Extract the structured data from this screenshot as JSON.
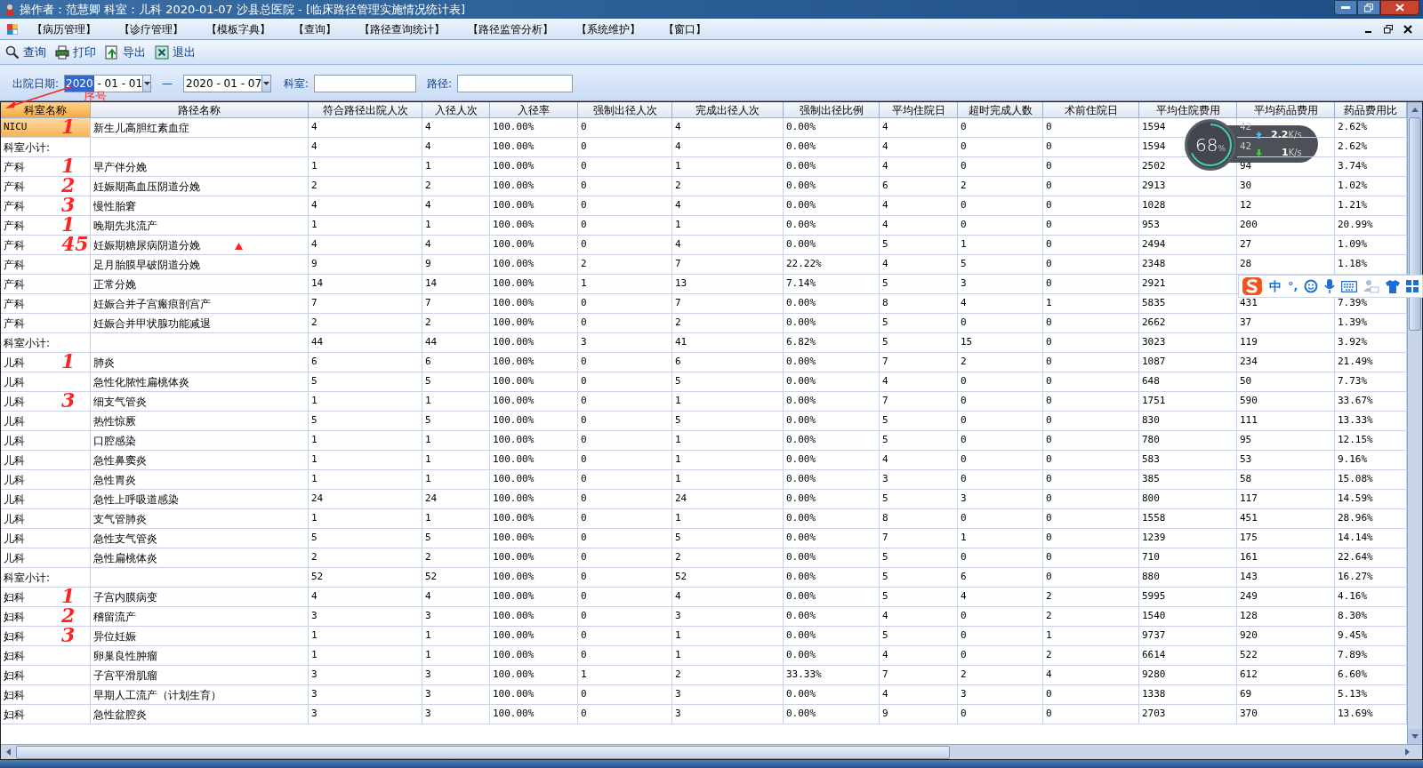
{
  "window": {
    "title": "操作者：范慧卿  科室：儿科  2020-01-07  沙县总医院 - [临床路径管理实施情况统计表]"
  },
  "menu": [
    "【病历管理】",
    "【诊疗管理】",
    "【模板字典】",
    "【查询】",
    "【路径查询统计】",
    "【路径监管分析】",
    "【系统维护】",
    "【窗口】"
  ],
  "toolbar": [
    {
      "kind": "search",
      "label": "查询"
    },
    {
      "kind": "print",
      "label": "打印"
    },
    {
      "kind": "export",
      "label": "导出"
    },
    {
      "kind": "exit",
      "label": "退出"
    }
  ],
  "filter": {
    "date_label": "出院日期:",
    "date_from": {
      "year": "2020",
      "rest": " - 01 - 01"
    },
    "separator": "—",
    "date_to": "2020 - 01 - 07",
    "dept_label": "科室:",
    "path_label": "路径:"
  },
  "annotation": {
    "text": "序号"
  },
  "table": {
    "columns": [
      {
        "label": "科室名称",
        "selected": true
      },
      {
        "label": "路径名称",
        "selected": false
      },
      {
        "label": "符合路径出院人次",
        "selected": false
      },
      {
        "label": "入径人次",
        "selected": false
      },
      {
        "label": "入径率",
        "selected": false
      },
      {
        "label": "强制出径人次",
        "selected": false
      },
      {
        "label": "完成出径人次",
        "selected": false
      },
      {
        "label": "强制出径比例",
        "selected": false
      },
      {
        "label": "平均住院日",
        "selected": false
      },
      {
        "label": "超时完成人数",
        "selected": false
      },
      {
        "label": "术前住院日",
        "selected": false
      },
      {
        "label": "平均住院费用",
        "selected": false
      },
      {
        "label": "平均药品费用",
        "selected": false
      },
      {
        "label": "药品费用比",
        "selected": false
      }
    ],
    "rows": [
      {
        "cells": [
          "NICU",
          "新生儿高胆红素血症",
          "4",
          "4",
          "100.00%",
          "0",
          "4",
          "0.00%",
          "4",
          "0",
          "0",
          "1594",
          "42",
          "2.62%"
        ],
        "selected": true,
        "flagged": false,
        "mark": "1"
      },
      {
        "cells": [
          "科室小计:",
          null,
          "4",
          "4",
          "100.00%",
          "0",
          "4",
          "0.00%",
          "4",
          "0",
          "0",
          "1594",
          "42",
          "2.62%"
        ],
        "selected": false,
        "flagged": false
      },
      {
        "cells": [
          "产科",
          "早产伴分娩",
          "1",
          "1",
          "100.00%",
          "0",
          "1",
          "0.00%",
          "4",
          "0",
          "0",
          "2502",
          "94",
          "3.74%"
        ],
        "selected": false,
        "flagged": false,
        "mark": "1"
      },
      {
        "cells": [
          "产科",
          "妊娠期高血压阴道分娩",
          "2",
          "2",
          "100.00%",
          "0",
          "2",
          "0.00%",
          "6",
          "2",
          "0",
          "2913",
          "30",
          "1.02%"
        ],
        "selected": false,
        "flagged": false,
        "mark": "2"
      },
      {
        "cells": [
          "产科",
          "慢性胎窘",
          "4",
          "4",
          "100.00%",
          "0",
          "4",
          "0.00%",
          "4",
          "0",
          "0",
          "1028",
          "12",
          "1.21%"
        ],
        "selected": false,
        "flagged": false,
        "mark": "3"
      },
      {
        "cells": [
          "产科",
          "晚期先兆流产",
          "1",
          "1",
          "100.00%",
          "0",
          "1",
          "0.00%",
          "4",
          "0",
          "0",
          "953",
          "200",
          "20.99%"
        ],
        "selected": false,
        "flagged": false,
        "mark": "1"
      },
      {
        "cells": [
          "产科",
          "妊娠期糖尿病阴道分娩",
          "4",
          "4",
          "100.00%",
          "0",
          "4",
          "0.00%",
          "5",
          "1",
          "0",
          "2494",
          "27",
          "1.09%"
        ],
        "selected": false,
        "flagged": true,
        "mark": "45"
      },
      {
        "cells": [
          "产科",
          "足月胎膜早破阴道分娩",
          "9",
          "9",
          "100.00%",
          "2",
          "7",
          "22.22%",
          "4",
          "5",
          "0",
          "2348",
          "28",
          "1.18%"
        ],
        "selected": false,
        "flagged": false
      },
      {
        "cells": [
          "产科",
          "正常分娩",
          "14",
          "14",
          "100.00%",
          "1",
          "13",
          "7.14%",
          "5",
          "3",
          "0",
          "2921",
          null,
          null
        ],
        "selected": false,
        "flagged": false
      },
      {
        "cells": [
          "产科",
          "妊娠合并子宫瘢痕剖宫产",
          "7",
          "7",
          "100.00%",
          "0",
          "7",
          "0.00%",
          "8",
          "4",
          "1",
          "5835",
          "431",
          "7.39%"
        ],
        "selected": false,
        "flagged": false
      },
      {
        "cells": [
          "产科",
          "妊娠合并甲状腺功能减退",
          "2",
          "2",
          "100.00%",
          "0",
          "2",
          "0.00%",
          "5",
          "0",
          "0",
          "2662",
          "37",
          "1.39%"
        ],
        "selected": false,
        "flagged": false
      },
      {
        "cells": [
          "科室小计:",
          null,
          "44",
          "44",
          "100.00%",
          "3",
          "41",
          "6.82%",
          "5",
          "15",
          "0",
          "3023",
          "119",
          "3.92%"
        ],
        "selected": false,
        "flagged": false
      },
      {
        "cells": [
          "儿科",
          "肺炎",
          "6",
          "6",
          "100.00%",
          "0",
          "6",
          "0.00%",
          "7",
          "2",
          "0",
          "1087",
          "234",
          "21.49%"
        ],
        "selected": false,
        "flagged": false,
        "mark": "1"
      },
      {
        "cells": [
          "儿科",
          "急性化脓性扁桃体炎",
          "5",
          "5",
          "100.00%",
          "0",
          "5",
          "0.00%",
          "4",
          "0",
          "0",
          "648",
          "50",
          "7.73%"
        ],
        "selected": false,
        "flagged": false
      },
      {
        "cells": [
          "儿科",
          "细支气管炎",
          "1",
          "1",
          "100.00%",
          "0",
          "1",
          "0.00%",
          "7",
          "0",
          "0",
          "1751",
          "590",
          "33.67%"
        ],
        "selected": false,
        "flagged": false,
        "mark": "3"
      },
      {
        "cells": [
          "儿科",
          "热性惊厥",
          "5",
          "5",
          "100.00%",
          "0",
          "5",
          "0.00%",
          "5",
          "0",
          "0",
          "830",
          "111",
          "13.33%"
        ],
        "selected": false,
        "flagged": false
      },
      {
        "cells": [
          "儿科",
          "口腔感染",
          "1",
          "1",
          "100.00%",
          "0",
          "1",
          "0.00%",
          "5",
          "0",
          "0",
          "780",
          "95",
          "12.15%"
        ],
        "selected": false,
        "flagged": false
      },
      {
        "cells": [
          "儿科",
          "急性鼻窦炎",
          "1",
          "1",
          "100.00%",
          "0",
          "1",
          "0.00%",
          "4",
          "0",
          "0",
          "583",
          "53",
          "9.16%"
        ],
        "selected": false,
        "flagged": false
      },
      {
        "cells": [
          "儿科",
          "急性胃炎",
          "1",
          "1",
          "100.00%",
          "0",
          "1",
          "0.00%",
          "3",
          "0",
          "0",
          "385",
          "58",
          "15.08%"
        ],
        "selected": false,
        "flagged": false
      },
      {
        "cells": [
          "儿科",
          "急性上呼吸道感染",
          "24",
          "24",
          "100.00%",
          "0",
          "24",
          "0.00%",
          "5",
          "3",
          "0",
          "800",
          "117",
          "14.59%"
        ],
        "selected": false,
        "flagged": false
      },
      {
        "cells": [
          "儿科",
          "支气管肺炎",
          "1",
          "1",
          "100.00%",
          "0",
          "1",
          "0.00%",
          "8",
          "0",
          "0",
          "1558",
          "451",
          "28.96%"
        ],
        "selected": false,
        "flagged": false
      },
      {
        "cells": [
          "儿科",
          "急性支气管炎",
          "5",
          "5",
          "100.00%",
          "0",
          "5",
          "0.00%",
          "7",
          "1",
          "0",
          "1239",
          "175",
          "14.14%"
        ],
        "selected": false,
        "flagged": false
      },
      {
        "cells": [
          "儿科",
          "急性扁桃体炎",
          "2",
          "2",
          "100.00%",
          "0",
          "2",
          "0.00%",
          "5",
          "0",
          "0",
          "710",
          "161",
          "22.64%"
        ],
        "selected": false,
        "flagged": false
      },
      {
        "cells": [
          "科室小计:",
          null,
          "52",
          "52",
          "100.00%",
          "0",
          "52",
          "0.00%",
          "5",
          "6",
          "0",
          "880",
          "143",
          "16.27%"
        ],
        "selected": false,
        "flagged": false
      },
      {
        "cells": [
          "妇科",
          "子宫内膜病变",
          "4",
          "4",
          "100.00%",
          "0",
          "4",
          "0.00%",
          "5",
          "4",
          "2",
          "5995",
          "249",
          "4.16%"
        ],
        "selected": false,
        "flagged": false,
        "mark": "1"
      },
      {
        "cells": [
          "妇科",
          "稽留流产",
          "3",
          "3",
          "100.00%",
          "0",
          "3",
          "0.00%",
          "4",
          "0",
          "2",
          "1540",
          "128",
          "8.30%"
        ],
        "selected": false,
        "flagged": false,
        "mark": "2"
      },
      {
        "cells": [
          "妇科",
          "异位妊娠",
          "1",
          "1",
          "100.00%",
          "0",
          "1",
          "0.00%",
          "5",
          "0",
          "1",
          "9737",
          "920",
          "9.45%"
        ],
        "selected": false,
        "flagged": false,
        "mark": "3"
      },
      {
        "cells": [
          "妇科",
          "卵巢良性肿瘤",
          "1",
          "1",
          "100.00%",
          "0",
          "1",
          "0.00%",
          "4",
          "0",
          "2",
          "6614",
          "522",
          "7.89%"
        ],
        "selected": false,
        "flagged": false
      },
      {
        "cells": [
          "妇科",
          "子宫平滑肌瘤",
          "3",
          "3",
          "100.00%",
          "1",
          "2",
          "33.33%",
          "7",
          "2",
          "4",
          "9280",
          "612",
          "6.60%"
        ],
        "selected": false,
        "flagged": false
      },
      {
        "cells": [
          "妇科",
          "早期人工流产（计划生育）",
          "3",
          "3",
          "100.00%",
          "0",
          "3",
          "0.00%",
          "4",
          "3",
          "0",
          "1338",
          "69",
          "5.13%"
        ],
        "selected": false,
        "flagged": false
      },
      {
        "cells": [
          "妇科",
          "急性盆腔炎",
          "3",
          "3",
          "100.00%",
          "0",
          "3",
          "0.00%",
          "9",
          "0",
          "0",
          "2703",
          "370",
          "13.69%"
        ],
        "selected": false,
        "flagged": false
      }
    ]
  },
  "net_widget": {
    "percent": "68",
    "percent_sign": "%",
    "up": "2.2",
    "up_unit": "K/s",
    "down": "1",
    "down_unit": "K/s"
  },
  "ime_bar": {
    "mode": "中",
    "punct": "°,"
  }
}
